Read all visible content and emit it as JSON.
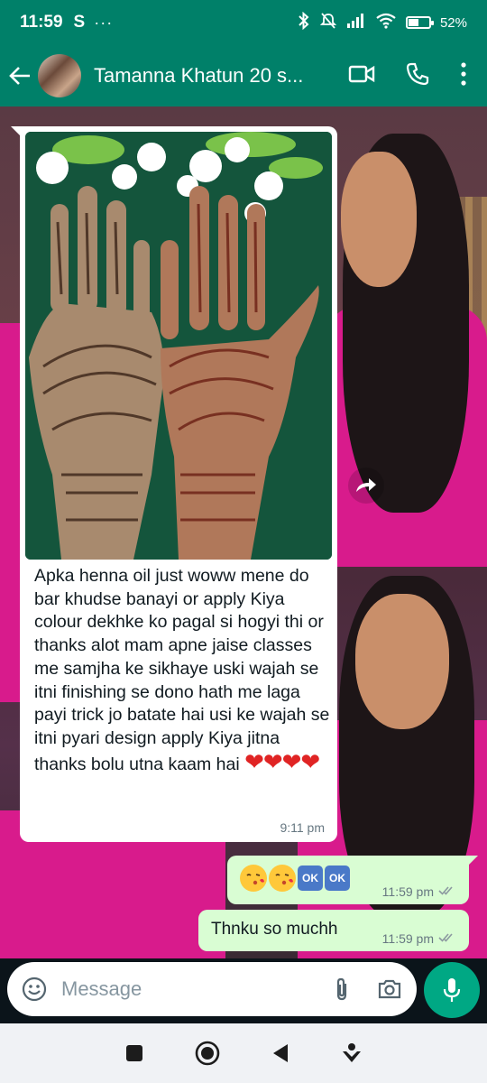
{
  "status_bar": {
    "time": "11:59",
    "app_letter": "S",
    "dots": "···",
    "battery_percent": "52",
    "battery_level": 0.52
  },
  "header": {
    "contact_name": "Tamanna Khatun 20 s...",
    "icons": [
      "back-arrow-icon",
      "video-call-icon",
      "phone-icon",
      "more-vert-icon"
    ]
  },
  "messages": {
    "incoming": {
      "text": "Apka henna oil just woww mene do bar khudse banayi or apply Kiya colour dekhke ko pagal si hogyi thi or thanks alot mam apne jaise classes me samjha ke sikhaye uski wajah se itni finishing se dono hath me laga payi trick jo batate hai usi ke wajah se itni pyari design apply Kiya jitna thanks bolu utna kaam hai",
      "hearts": "❤❤❤❤",
      "time": "9:11 pm",
      "image": "henna-hands-photo"
    },
    "outgoing_1": {
      "ok_1": "OK",
      "ok_2": "OK",
      "time": "11:59 pm",
      "status": "read"
    },
    "outgoing_2": {
      "text": "Thnku so muchh",
      "time": "11:59 pm",
      "status": "read"
    }
  },
  "input": {
    "placeholder": "Message"
  },
  "colors": {
    "brand": "#008069",
    "accent": "#00a884",
    "outgoing_bubble": "#d9fdd3",
    "incoming_bubble": "#ffffff",
    "read_tick": "#53bdeb"
  }
}
